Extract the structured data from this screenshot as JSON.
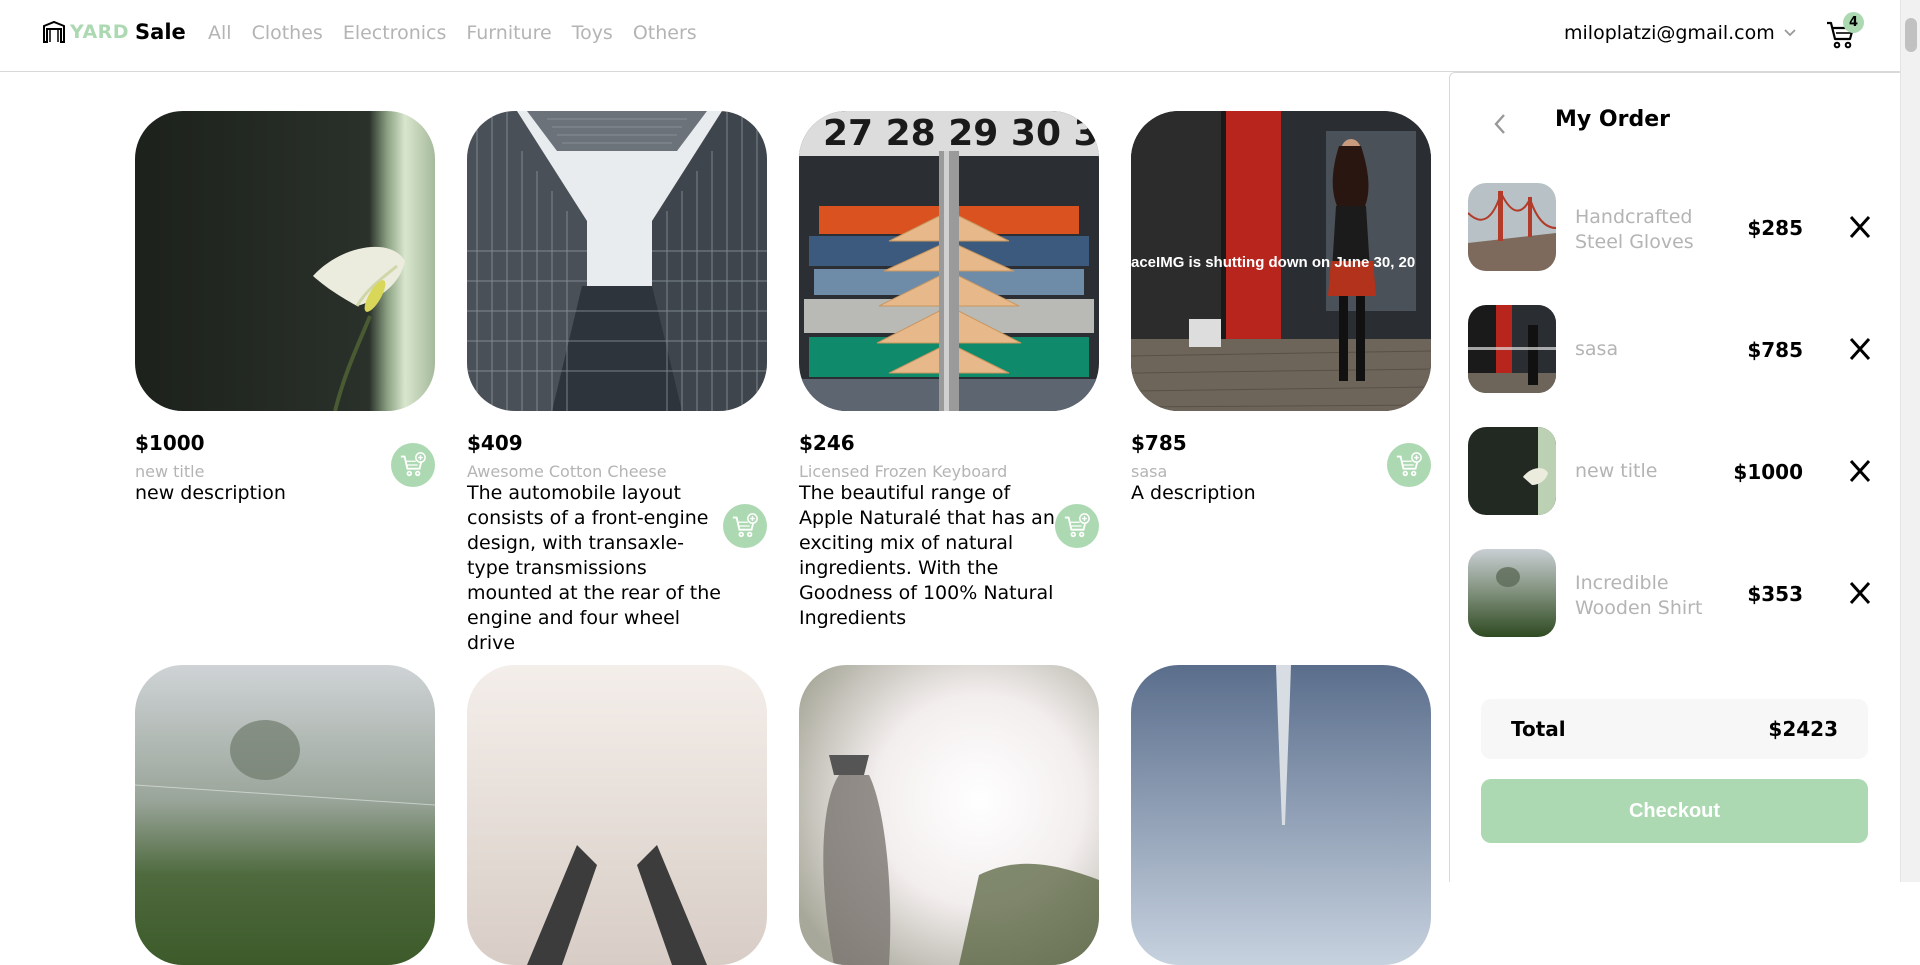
{
  "header": {
    "logo_yard": "YARD",
    "logo_sale": "Sale",
    "nav": [
      "All",
      "Clothes",
      "Electronics",
      "Furniture",
      "Toys",
      "Others"
    ],
    "email": "miloplatzi@gmail.com",
    "cart_count": "4"
  },
  "products": [
    {
      "price": "$1000",
      "title": "new title",
      "description": "new description"
    },
    {
      "price": "$409",
      "title": "Awesome Cotton Cheese",
      "description": "The automobile layout consists of a front-engine design, with transaxle-type transmissions mounted at the rear of the engine and four wheel drive"
    },
    {
      "price": "$246",
      "title": "Licensed Frozen Keyboard",
      "description": "The beautiful range of Apple Naturalé that has an exciting mix of natural ingredients. With the Goodness of 100% Natural Ingredients"
    },
    {
      "price": "$785",
      "title": "sasa",
      "description": "A description",
      "overlay_text": "aceIMG is shutting down on June 30, 20"
    }
  ],
  "rack_numbers": "27 28 29 30 3",
  "order": {
    "title": "My Order",
    "items": [
      {
        "name": "Handcrafted Steel Gloves",
        "price": "$285",
        "remove": "X"
      },
      {
        "name": "sasa",
        "price": "$785",
        "remove": "X"
      },
      {
        "name": "new title",
        "price": "$1000",
        "remove": "X"
      },
      {
        "name": "Incredible Wooden Shirt",
        "price": "$353",
        "remove": "X"
      }
    ],
    "total_label": "Total",
    "total_value": "$2423",
    "checkout_label": "Checkout"
  },
  "colors": {
    "accent": "#acd9b2",
    "muted_text": "#b4b4b4"
  }
}
